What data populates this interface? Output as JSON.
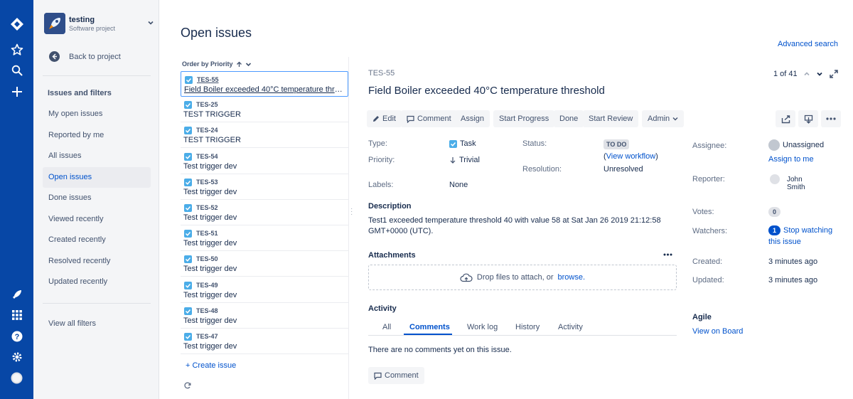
{
  "project": {
    "name": "testing",
    "type": "Software project"
  },
  "sidebar": {
    "back_label": "Back to project",
    "section_title": "Issues and filters",
    "items": [
      {
        "label": "My open issues"
      },
      {
        "label": "Reported by me"
      },
      {
        "label": "All issues"
      },
      {
        "label": "Open issues"
      },
      {
        "label": "Done issues"
      },
      {
        "label": "Viewed recently"
      },
      {
        "label": "Created recently"
      },
      {
        "label": "Resolved recently"
      },
      {
        "label": "Updated recently"
      }
    ],
    "view_all_filters": "View all filters"
  },
  "page": {
    "title": "Open issues",
    "advanced_search": "Advanced search"
  },
  "list": {
    "order_label": "Order by Priority",
    "issues": [
      {
        "key": "TES-55",
        "summary": "Field Boiler exceeded 40°C temperature threshold"
      },
      {
        "key": "TES-25",
        "summary": "TEST TRIGGER"
      },
      {
        "key": "TES-24",
        "summary": "TEST TRIGGER"
      },
      {
        "key": "TES-54",
        "summary": "Test trigger dev"
      },
      {
        "key": "TES-53",
        "summary": "Test trigger dev"
      },
      {
        "key": "TES-52",
        "summary": "Test trigger dev"
      },
      {
        "key": "TES-51",
        "summary": "Test trigger dev"
      },
      {
        "key": "TES-50",
        "summary": "Test trigger dev"
      },
      {
        "key": "TES-49",
        "summary": "Test trigger dev"
      },
      {
        "key": "TES-48",
        "summary": "Test trigger dev"
      },
      {
        "key": "TES-47",
        "summary": "Test trigger dev"
      }
    ],
    "create_issue": "+ Create issue"
  },
  "detail": {
    "key": "TES-55",
    "title": "Field Boiler exceeded 40°C temperature threshold",
    "pager": "1 of 41",
    "toolbar": {
      "edit": "Edit",
      "comment": "Comment",
      "assign": "Assign",
      "start_progress": "Start Progress",
      "done": "Done",
      "start_review": "Start Review",
      "admin": "Admin"
    },
    "fields": {
      "type_label": "Type:",
      "type_value": "Task",
      "priority_label": "Priority:",
      "priority_value": "Trivial",
      "labels_label": "Labels:",
      "labels_value": "None",
      "status_label": "Status:",
      "status_value": "TO DO",
      "view_workflow": "View workflow",
      "resolution_label": "Resolution:",
      "resolution_value": "Unresolved"
    },
    "description_heading": "Description",
    "description": "Test1 exceeded temperature threshold 40 with value 58 at Sat Jan 26 2019 21:12:58 GMT+0000 (UTC).",
    "attachments_heading": "Attachments",
    "drop_text": "Drop files to attach, or",
    "browse": "browse.",
    "activity_heading": "Activity",
    "activity_tabs": [
      "All",
      "Comments",
      "Work log",
      "History",
      "Activity"
    ],
    "no_comments": "There are no comments yet on this issue.",
    "comment_button": "Comment"
  },
  "people": {
    "assignee_label": "Assignee:",
    "assignee_value": "Unassigned",
    "assign_to_me": "Assign to me",
    "reporter_label": "Reporter:",
    "reporter_first": "John",
    "reporter_last": "Smith",
    "votes_label": "Votes:",
    "votes_count": "0",
    "watchers_label": "Watchers:",
    "watchers_count": "1",
    "stop_watching_1": "Stop watching",
    "stop_watching_2": "this issue",
    "created_label": "Created:",
    "created_value": "3 minutes ago",
    "updated_label": "Updated:",
    "updated_value": "3 minutes ago",
    "agile_heading": "Agile",
    "view_on_board": "View on Board"
  },
  "colors": {
    "global_nav": "#0747a6",
    "link": "#0052cc",
    "checkbox": "#4bade8"
  }
}
